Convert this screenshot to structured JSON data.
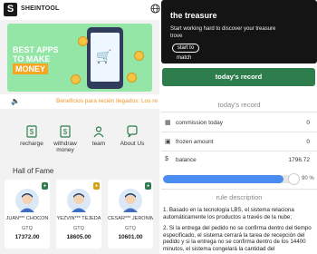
{
  "header": {
    "logo_letter": "S",
    "brand": "SHEINTOOL",
    "globe_icon": "globe-icon"
  },
  "banner": {
    "line1": "BEST APPS",
    "line2": "TO MAKE",
    "line3": "MONEY",
    "bg": "#93e6a6",
    "accent": "#f4a623"
  },
  "notice": {
    "icon": "speaker-icon",
    "text": "Beneficios para recién llegados: Los re"
  },
  "menu": [
    {
      "label": "recharge",
      "icon": "recharge-icon"
    },
    {
      "label": "withdraw money",
      "icon": "withdraw-icon"
    },
    {
      "label": "team",
      "icon": "team-icon"
    },
    {
      "label": "About Us",
      "icon": "about-icon"
    }
  ],
  "hall_of_fame": {
    "title": "Hall of Fame",
    "cards": [
      {
        "name": "JUAN*** CHOCÓN",
        "currency": "GTQ",
        "amount": "17372.00",
        "badge_color": "#2e7d4c"
      },
      {
        "name": "YEZVIN*** TEJEDA",
        "currency": "GTQ",
        "amount": "18605.00",
        "badge_color": "#d4a017"
      },
      {
        "name": "CESAR*** JERÓNIMO",
        "currency": "GTQ",
        "amount": "10601.00",
        "badge_color": "#2e7d4c"
      }
    ]
  },
  "hero": {
    "title": "the treasure",
    "subtitle": "Start working hard to discover your treasure trove",
    "start_label": "start to",
    "match_label": "match"
  },
  "today_record_button": "today's record",
  "today_record": {
    "title": "today's record",
    "commission_label": "commission today",
    "commission_value": "0",
    "frozen_label": "frozen amount",
    "frozen_value": "0",
    "balance_label": "balance",
    "balance_value": "1796.72"
  },
  "progress": {
    "percent": 90,
    "label": "90  %"
  },
  "rules": {
    "title": "rule description",
    "items": [
      "1. Basado en la tecnología LBS, el sistema relaciona automáticamente los productos a través de la nube;",
      "2. Si la entrega del pedido no se confirma dentro del tiempo especificado, el sistema cerrará la tarea de recepción del pedido y si la entrega no se confirma dentro de los 14400 minutos, el sistema congelará la cantidad del"
    ]
  },
  "colors": {
    "primary_green": "#2e7d4c",
    "progress_blue": "#4a8cf0",
    "notice_orange": "#f0962a"
  }
}
